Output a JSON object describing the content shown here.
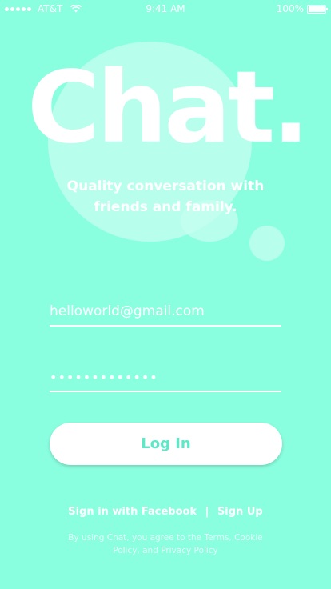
{
  "status_bar": {
    "carrier": "AT&T",
    "time": "9:41 AM",
    "battery": "100%"
  },
  "logo": {
    "text": "Chat."
  },
  "tagline": {
    "line1": "Quality conversation with",
    "line2": "friends and family."
  },
  "login_form": {
    "email_value": "helloworld@gmail.com",
    "password_value": "•••••••••••••"
  },
  "login_button": {
    "label": "Log In"
  },
  "links": {
    "facebook": "Sign in with Facebook",
    "separator": "|",
    "signup": "Sign Up"
  },
  "legal": {
    "line1": "By using Chat, you agree to the Terms, Cookie",
    "line2": "Policy, and Privacy Policy"
  },
  "colors": {
    "background": "#8affe0",
    "bubble": "#c5fff0",
    "button_text": "#5ee8c6"
  }
}
